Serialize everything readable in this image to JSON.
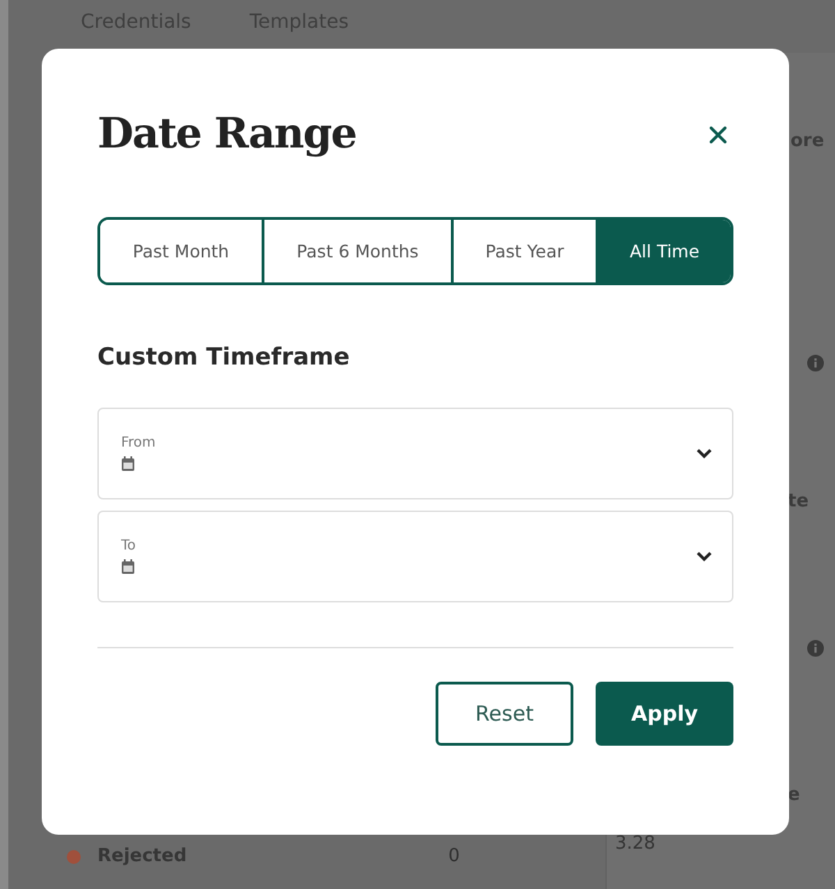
{
  "background": {
    "tabs": [
      "Credentials",
      "Templates"
    ],
    "side_texts": [
      {
        "kind": "text",
        "text": "ore"
      },
      {
        "kind": "info"
      },
      {
        "kind": "text",
        "text": "te"
      },
      {
        "kind": "info"
      },
      {
        "kind": "text",
        "text": "e"
      },
      {
        "kind": "value",
        "text": "3.28"
      }
    ],
    "status_row": {
      "label": "Rejected",
      "count": "0",
      "color": "#a0503c"
    }
  },
  "dialog": {
    "title": "Date Range",
    "ranges": [
      {
        "label": "Past Month",
        "selected": false
      },
      {
        "label": "Past 6 Months",
        "selected": false
      },
      {
        "label": "Past Year",
        "selected": false
      },
      {
        "label": "All Time",
        "selected": true
      }
    ],
    "section_title": "Custom Timeframe",
    "fields": [
      {
        "label": "From"
      },
      {
        "label": "To"
      }
    ],
    "buttons": [
      {
        "label": "Reset",
        "kind": "secondary"
      },
      {
        "label": "Apply",
        "kind": "primary"
      }
    ]
  }
}
